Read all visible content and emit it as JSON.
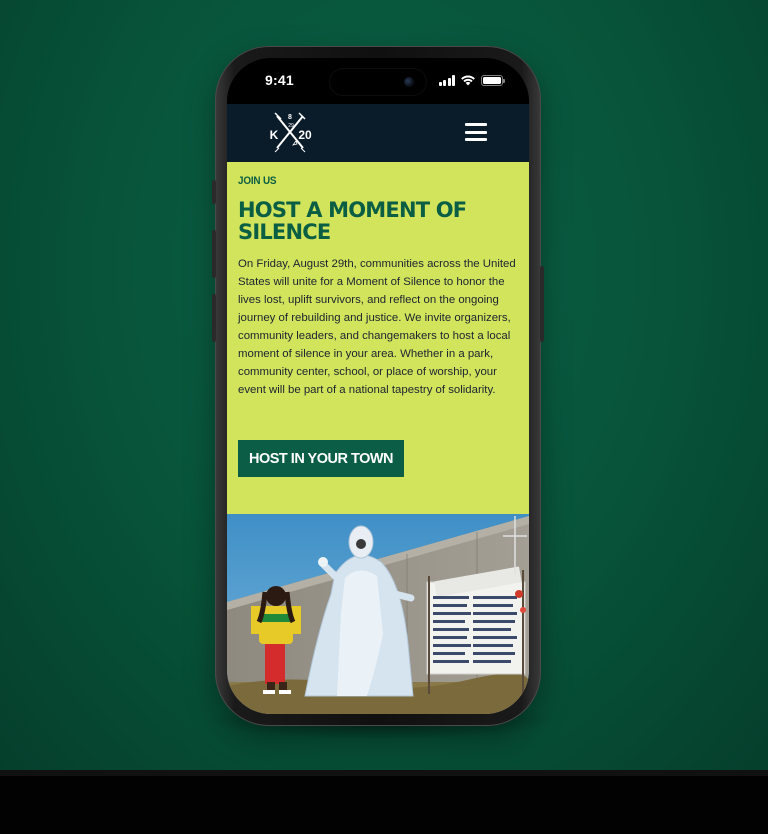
{
  "status_bar": {
    "time": "9:41"
  },
  "header": {
    "logo": {
      "top": "8",
      "middle": "29",
      "left": "K",
      "right": "20"
    }
  },
  "section": {
    "eyebrow": "JOIN US",
    "headline": "HOST A MOMENT OF SILENCE",
    "body": "On Friday, August 29th, communities across the United States will unite for a Moment of Silence to honor the lives lost, uplift survivors, and reflect on the ongoing journey of rebuilding and justice. We invite organizers, community leaders, and changemakers to host a local moment of silence in your area. Whether in a park, community center, school, or place of worship, your event will be part of a national tapestry of solidarity.",
    "cta_label": "HOST IN YOUR TOWN"
  },
  "icons": [
    "signal-icon",
    "wifi-icon",
    "battery-icon",
    "menu-icon"
  ],
  "colors": {
    "background": "#075339",
    "header": "#0a1b2a",
    "section_bg": "#d2e35c",
    "accent": "#0a5e43",
    "body_text": "#1b2330"
  }
}
